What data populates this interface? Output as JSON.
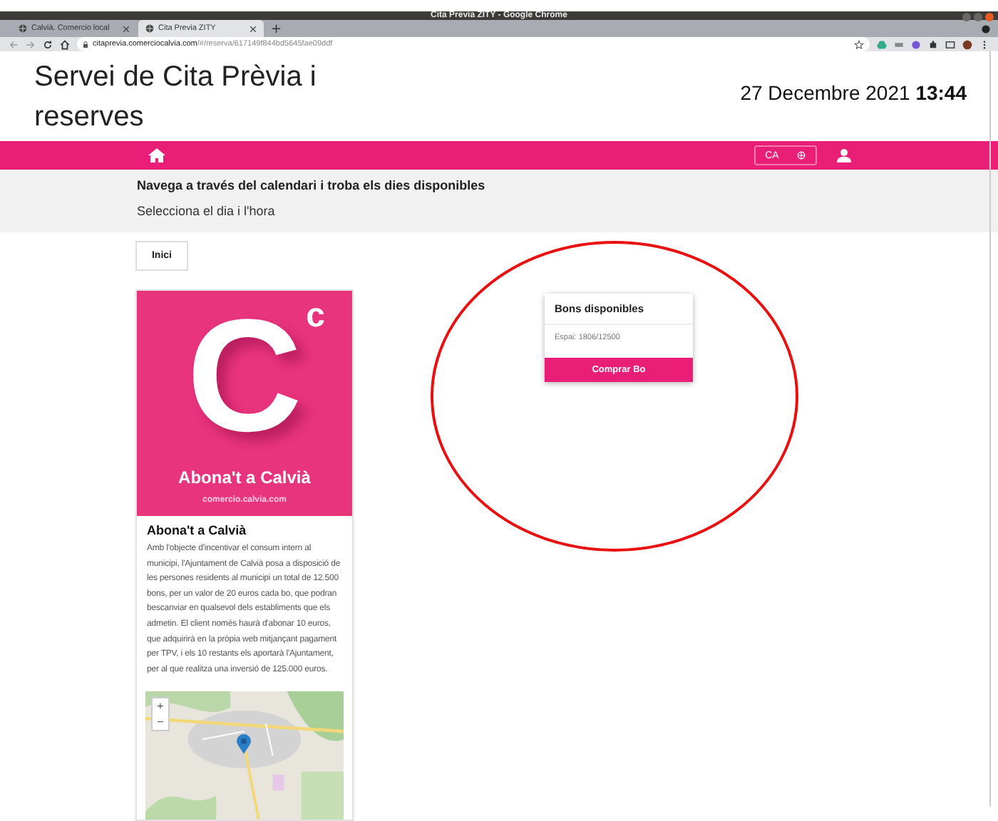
{
  "browser": {
    "title": "Cita Previa ZITY - Google Chrome",
    "tabs": [
      {
        "label": "Calvià. Comercio local",
        "selected": false
      },
      {
        "label": "Cita Previa ZITY",
        "selected": true
      }
    ],
    "new_tab": "+",
    "url_host": "citaprevia.comerciocalvia.com",
    "url_path": "/#/reserva/617149f844bd5645fae09ddf"
  },
  "header": {
    "title": "Servei de Cita Prèvia i reserves",
    "date": "27 Decembre 2021",
    "time": "13:44"
  },
  "navbar": {
    "language": "CA"
  },
  "intro": {
    "heading": "Navega a través del calendari i troba els dies disponibles",
    "subheading": "Selecciona el dia i l'hora"
  },
  "breadcrumb": "Inici",
  "card": {
    "banner_letter": "C",
    "banner_superscript": "c",
    "banner_title": "Abona't a Calvià",
    "banner_site": "comercio.calvia.com",
    "title": "Abona't a Calvià",
    "text": "Amb l'objecte d'incentivar el consum intern al municipi, l'Ajuntament de Calvià posa a disposició de les persones residents al municipi un total de 12.500 bons, per un valor de 20 euros cada bo, que podran bescanviar en qualsevol dels establiments que els admetin. El client només haurà d'abonar 10 euros, que adquirirà en la pròpia web mitjançant pagament per TPV, i els 10 restants els aportarà l'Ajuntament, per al que realitza una inversió de 125.000 euros.",
    "map": {
      "kind": "picture",
      "zoom_in": "+",
      "zoom_out": "−"
    }
  },
  "bons": {
    "title": "Bons disponibles",
    "space": "Espai: 1806/12500",
    "button": "Comprar Bo"
  },
  "annotation": {
    "kind": "ellipse"
  }
}
